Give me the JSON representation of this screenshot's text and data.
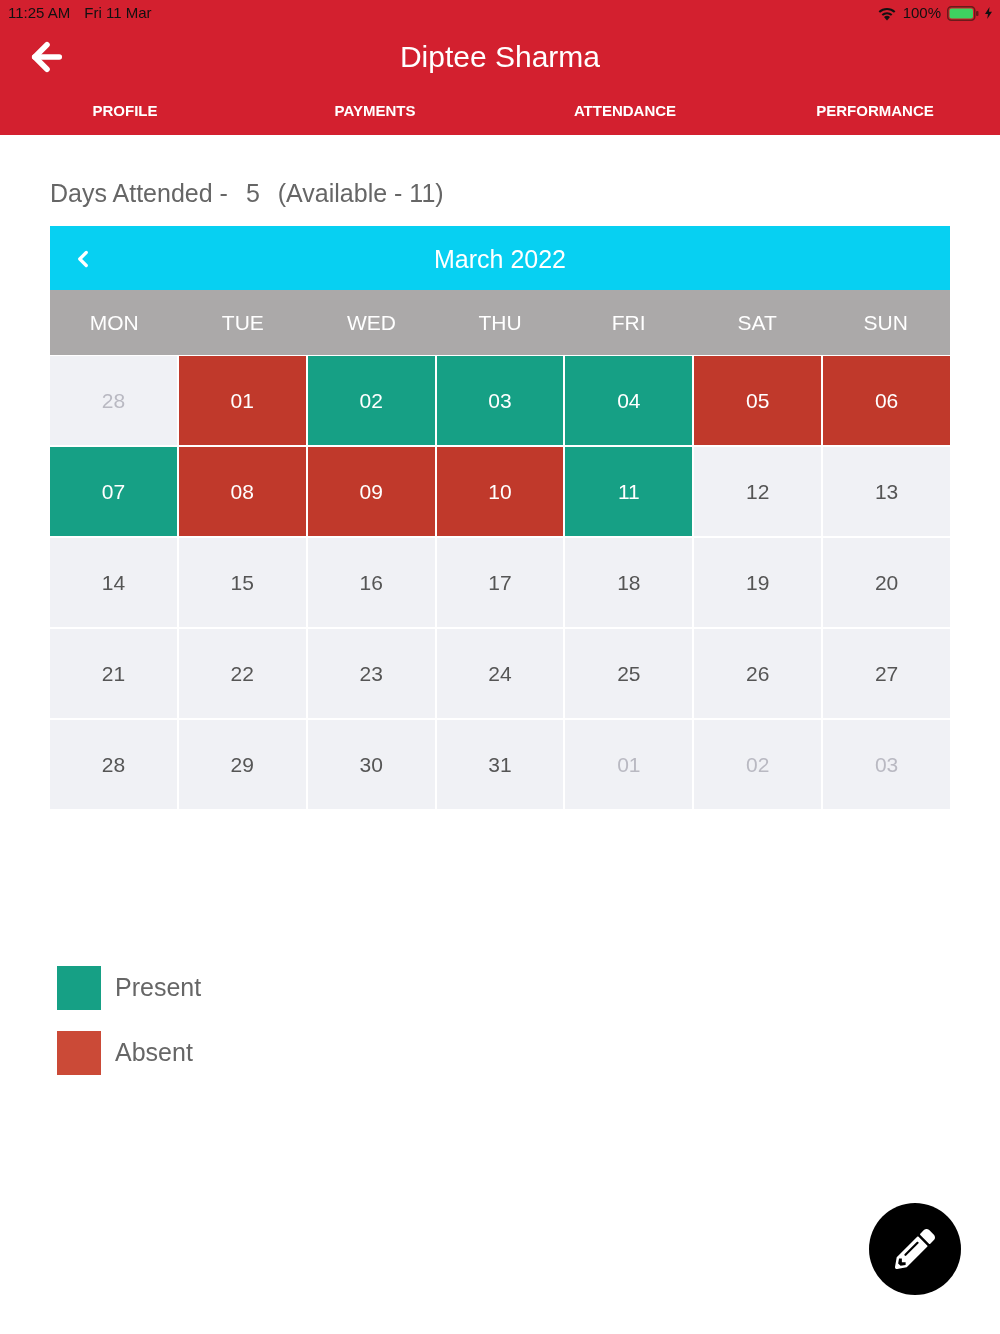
{
  "status_bar": {
    "time": "11:25 AM",
    "date": "Fri 11 Mar",
    "battery": "100%"
  },
  "header": {
    "title": "Diptee Sharma"
  },
  "tabs": [
    {
      "label": "PROFILE"
    },
    {
      "label": "PAYMENTS"
    },
    {
      "label": "ATTENDANCE"
    },
    {
      "label": "PERFORMANCE"
    }
  ],
  "summary": {
    "label": "Days Attended -",
    "attended": "5",
    "available": "(Available - 11)"
  },
  "calendar": {
    "month": "March 2022",
    "weekdays": [
      "MON",
      "TUE",
      "WED",
      "THU",
      "FRI",
      "SAT",
      "SUN"
    ],
    "days": [
      {
        "label": "28",
        "outside": true
      },
      {
        "label": "01",
        "outside": false,
        "color": "#c0392b"
      },
      {
        "label": "02",
        "outside": false,
        "color": "#16a085"
      },
      {
        "label": "03",
        "outside": false,
        "color": "#16a085"
      },
      {
        "label": "04",
        "outside": false,
        "color": "#16a085"
      },
      {
        "label": "05",
        "outside": false,
        "color": "#c0392b"
      },
      {
        "label": "06",
        "outside": false,
        "color": "#c0392b"
      },
      {
        "label": "07",
        "outside": false,
        "color": "#16a085"
      },
      {
        "label": "08",
        "outside": false,
        "color": "#c0392b"
      },
      {
        "label": "09",
        "outside": false,
        "color": "#c0392b"
      },
      {
        "label": "10",
        "outside": false,
        "color": "#c0392b"
      },
      {
        "label": "11",
        "outside": false,
        "color": "#16a085"
      },
      {
        "label": "12",
        "outside": false
      },
      {
        "label": "13",
        "outside": false
      },
      {
        "label": "14",
        "outside": false
      },
      {
        "label": "15",
        "outside": false
      },
      {
        "label": "16",
        "outside": false
      },
      {
        "label": "17",
        "outside": false
      },
      {
        "label": "18",
        "outside": false
      },
      {
        "label": "19",
        "outside": false
      },
      {
        "label": "20",
        "outside": false
      },
      {
        "label": "21",
        "outside": false
      },
      {
        "label": "22",
        "outside": false
      },
      {
        "label": "23",
        "outside": false
      },
      {
        "label": "24",
        "outside": false
      },
      {
        "label": "25",
        "outside": false
      },
      {
        "label": "26",
        "outside": false
      },
      {
        "label": "27",
        "outside": false
      },
      {
        "label": "28",
        "outside": false
      },
      {
        "label": "29",
        "outside": false
      },
      {
        "label": "30",
        "outside": false
      },
      {
        "label": "31",
        "outside": false
      },
      {
        "label": "01",
        "outside": true
      },
      {
        "label": "02",
        "outside": true
      },
      {
        "label": "03",
        "outside": true
      }
    ]
  },
  "legend": [
    {
      "label": "Present",
      "color": "#16a085"
    },
    {
      "label": "Absent",
      "color": "#cb4a37"
    }
  ]
}
